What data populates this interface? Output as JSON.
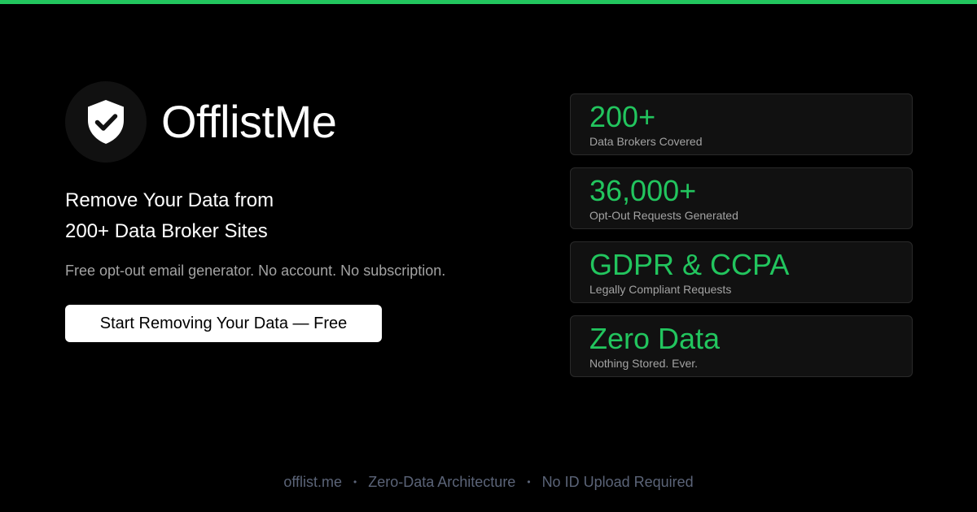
{
  "colors": {
    "background": "#000000",
    "accent": "#22c55e",
    "card_background": "#111111",
    "muted_text": "#a3a3a3",
    "footer_text": "#5b6478"
  },
  "brand": {
    "name": "OfflistMe",
    "logo_icon": "shield-check-icon"
  },
  "hero": {
    "headline_line1": "Remove Your Data from",
    "headline_line2": "200+ Data Broker Sites",
    "subline": "Free opt-out email generator. No account. No subscription.",
    "cta_label": "Start Removing Your Data — Free"
  },
  "stats": [
    {
      "value": "200+",
      "label": "Data Brokers Covered"
    },
    {
      "value": "36,000+",
      "label": "Opt-Out Requests Generated"
    },
    {
      "value": "GDPR & CCPA",
      "label": "Legally Compliant Requests"
    },
    {
      "value": "Zero Data",
      "label": "Nothing Stored. Ever."
    }
  ],
  "footer": {
    "items": [
      "offlist.me",
      "Zero-Data Architecture",
      "No ID Upload Required"
    ],
    "separator": "•"
  }
}
